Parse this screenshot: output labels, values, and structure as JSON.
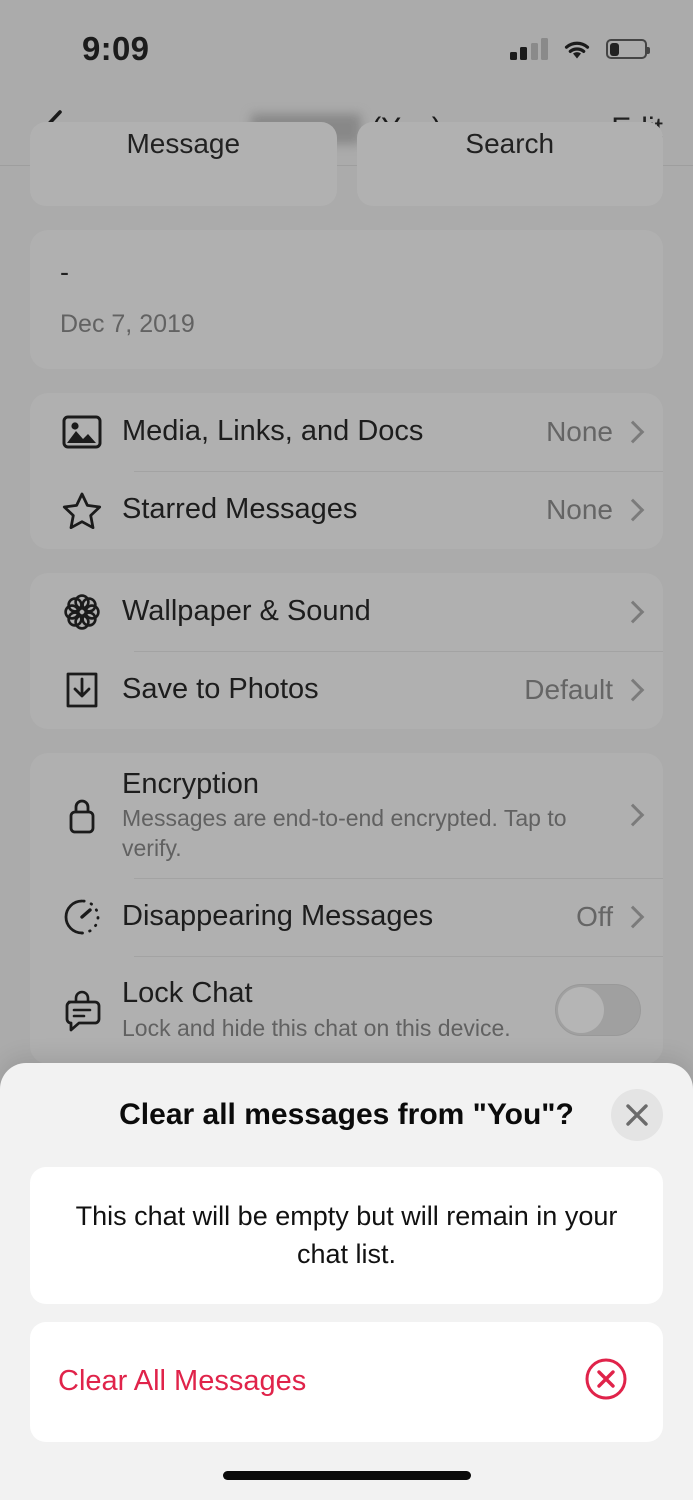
{
  "status_bar": {
    "time": "9:09",
    "signal_bars_filled": 2,
    "signal_bars_total": 4,
    "wifi": "wifi-icon",
    "battery_percent": 25
  },
  "nav": {
    "back_icon": "chevron-left-icon",
    "title_suffix": "(You)",
    "name_redacted": true,
    "edit_label": "Edit"
  },
  "quick_actions": [
    {
      "label": "Message",
      "icon": "message-icon"
    },
    {
      "label": "Search",
      "icon": "search-icon"
    }
  ],
  "about_card": {
    "status_text": "-",
    "date": "Dec 7, 2019"
  },
  "media_group": [
    {
      "icon": "photo-icon",
      "title": "Media, Links, and Docs",
      "value": "None",
      "chevron": true
    },
    {
      "icon": "star-icon",
      "title": "Starred Messages",
      "value": "None",
      "chevron": true
    }
  ],
  "appearance_group": [
    {
      "icon": "rosette-flower-icon",
      "title": "Wallpaper & Sound",
      "value": "",
      "chevron": true
    },
    {
      "icon": "download-icon",
      "title": "Save to Photos",
      "value": "Default",
      "chevron": true
    }
  ],
  "privacy_group": [
    {
      "icon": "lock-icon",
      "title": "Encryption",
      "subtitle": "Messages are end-to-end encrypted. Tap to verify.",
      "value": "",
      "chevron": true
    },
    {
      "icon": "timer-icon",
      "title": "Disappearing Messages",
      "value": "Off",
      "chevron": true
    },
    {
      "icon": "lock-chat-icon",
      "title": "Lock Chat",
      "subtitle": "Lock and hide this chat on this device.",
      "toggle": "off"
    }
  ],
  "sheet": {
    "title": "Clear all messages from \"You\"?",
    "close_icon": "close-icon",
    "description": "This chat will be empty but will remain in your chat list.",
    "action_label": "Clear All Messages",
    "action_icon": "x-circle-icon",
    "action_color": "#e0234a"
  },
  "colors": {
    "page_bg": "#b5b5b5",
    "sheet_bg": "#f2f2f2",
    "card_bg": "#ffffff",
    "danger": "#e0234a"
  }
}
